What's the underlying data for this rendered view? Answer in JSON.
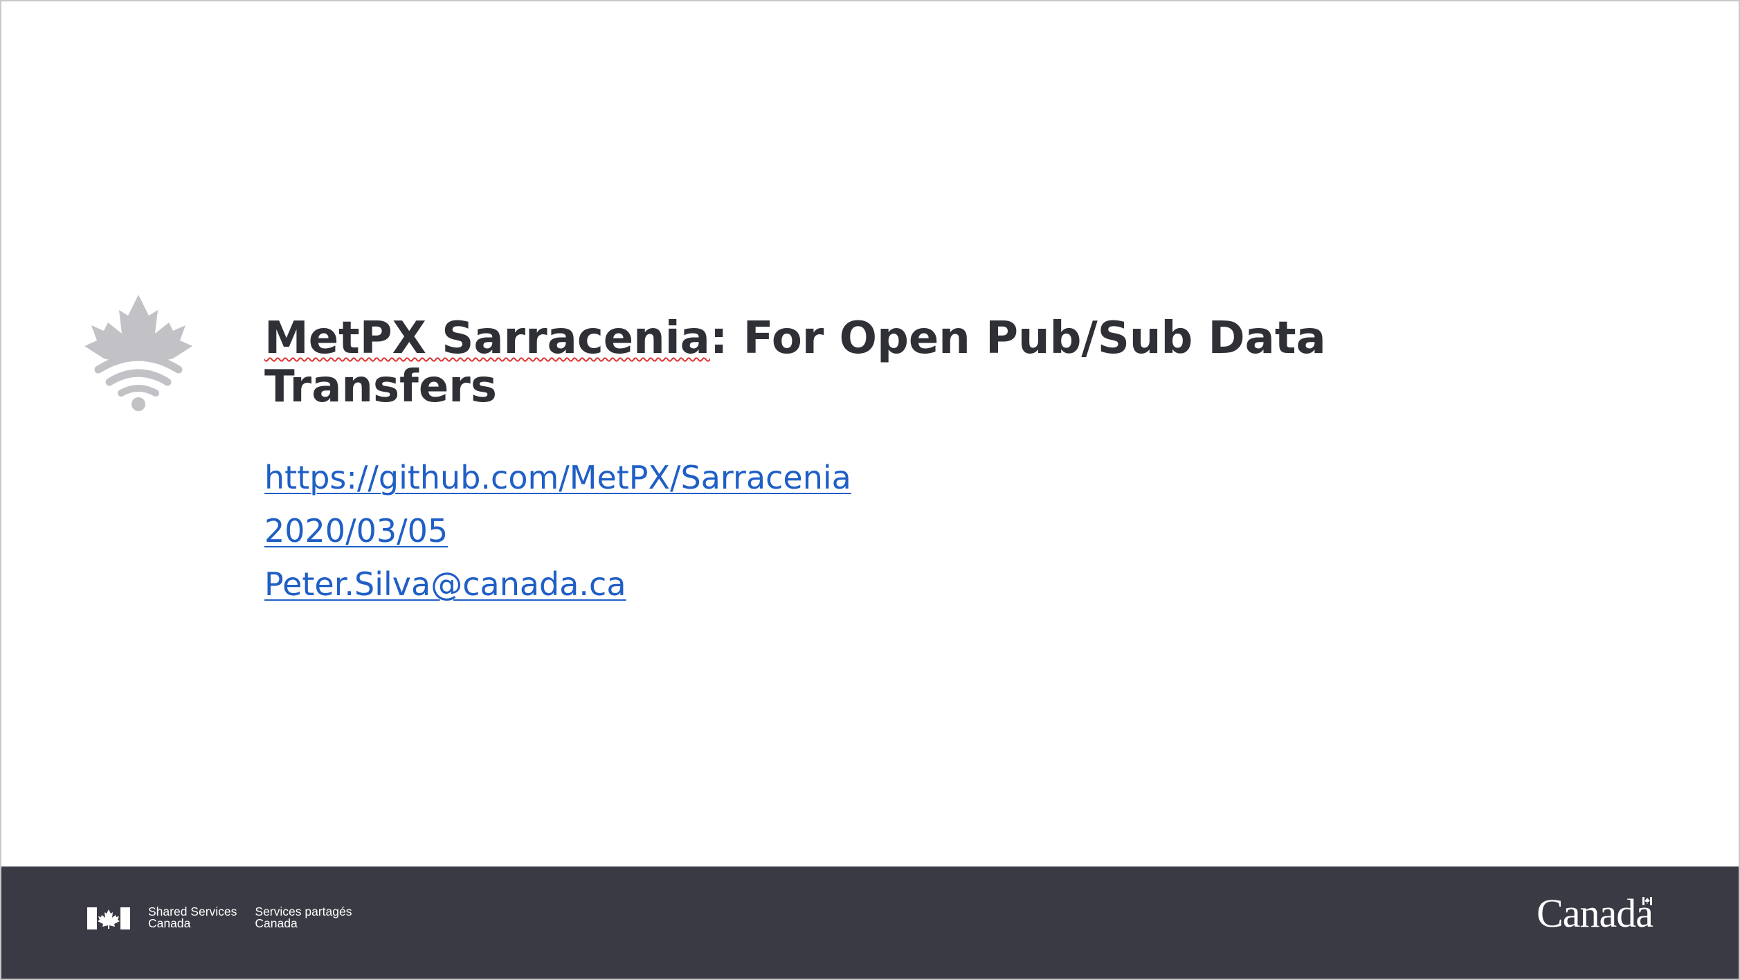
{
  "slide": {
    "title_part1": "MetPX Sarracenia",
    "title_part2": ": For Open Pub/Sub Data Transfers",
    "links": [
      "https://github.com/MetPX/Sarracenia",
      "2020/03/05",
      "Peter.Silva@canada.ca"
    ]
  },
  "footer": {
    "ssc_en_line1": "Shared Services",
    "ssc_en_line2": "Canada",
    "ssc_fr_line1": "Services partagés",
    "ssc_fr_line2": "Canada",
    "wordmark": "Canada"
  },
  "icons": {
    "slide_logo": "maple-leaf-wifi-icon",
    "footer_flag": "canada-flag-icon"
  },
  "colors": {
    "title": "#2f3036",
    "link": "#1f5fc6",
    "footer_bg": "#393a44",
    "logo_gray": "#c1c1c6"
  }
}
